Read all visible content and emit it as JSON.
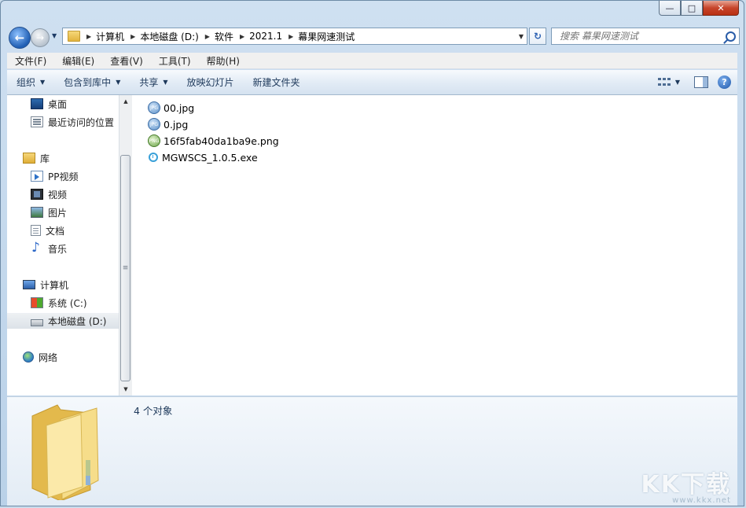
{
  "window": {
    "caption": {
      "minimize": "—",
      "maximize": "□",
      "close": "✕"
    }
  },
  "navigation": {
    "back_glyph": "←",
    "forward_glyph": "→",
    "history_dropdown": "▼",
    "breadcrumb": [
      "计算机",
      "本地磁盘 (D:)",
      "软件",
      "2021.1",
      "幕果网速测试"
    ],
    "address_dropdown": "▼",
    "refresh_glyph": "↻",
    "search_placeholder": "搜索 幕果网速测试"
  },
  "menu": [
    "文件(F)",
    "编辑(E)",
    "查看(V)",
    "工具(T)",
    "帮助(H)"
  ],
  "commands": [
    {
      "label": "组织",
      "dropdown": true
    },
    {
      "label": "包含到库中",
      "dropdown": true
    },
    {
      "label": "共享",
      "dropdown": true
    },
    {
      "label": "放映幻灯片",
      "dropdown": false
    },
    {
      "label": "新建文件夹",
      "dropdown": false
    }
  ],
  "cmd_arrow": "▼",
  "help_glyph": "?",
  "nav_pane": {
    "items": [
      {
        "label": "桌面",
        "icon": "desktop-icon"
      },
      {
        "label": "最近访问的位置",
        "icon": "recent-places-icon"
      },
      {
        "label": "库",
        "icon": "libraries-icon"
      },
      {
        "label": "PP视频",
        "icon": "pp-video-icon"
      },
      {
        "label": "视频",
        "icon": "videos-icon"
      },
      {
        "label": "图片",
        "icon": "pictures-icon"
      },
      {
        "label": "文档",
        "icon": "documents-icon"
      },
      {
        "label": "音乐",
        "icon": "music-icon"
      },
      {
        "label": "计算机",
        "icon": "computer-icon"
      },
      {
        "label": "系统 (C:)",
        "icon": "system-drive-icon"
      },
      {
        "label": "本地磁盘 (D:)",
        "icon": "local-disk-icon",
        "selected": true
      },
      {
        "label": "网络",
        "icon": "network-icon"
      }
    ]
  },
  "scrollbar": {
    "up": "▲",
    "down": "▼",
    "grip": "≡"
  },
  "files": [
    {
      "name": "00.jpg",
      "type": "jpg",
      "badge": "JPG"
    },
    {
      "name": "0.jpg",
      "type": "jpg",
      "badge": "JPG"
    },
    {
      "name": "16f5fab40da1ba9e.png",
      "type": "png",
      "badge": "PNG"
    },
    {
      "name": "MGWSCS_1.0.5.exe",
      "type": "exe"
    }
  ],
  "details": {
    "count_text": "4 个对象"
  },
  "watermark": {
    "big": "KK下载",
    "small": "www.kkx.net"
  },
  "colors": {
    "accent": "#1e395b",
    "selection": "#dce2e8",
    "close_red": "#c7452b"
  }
}
